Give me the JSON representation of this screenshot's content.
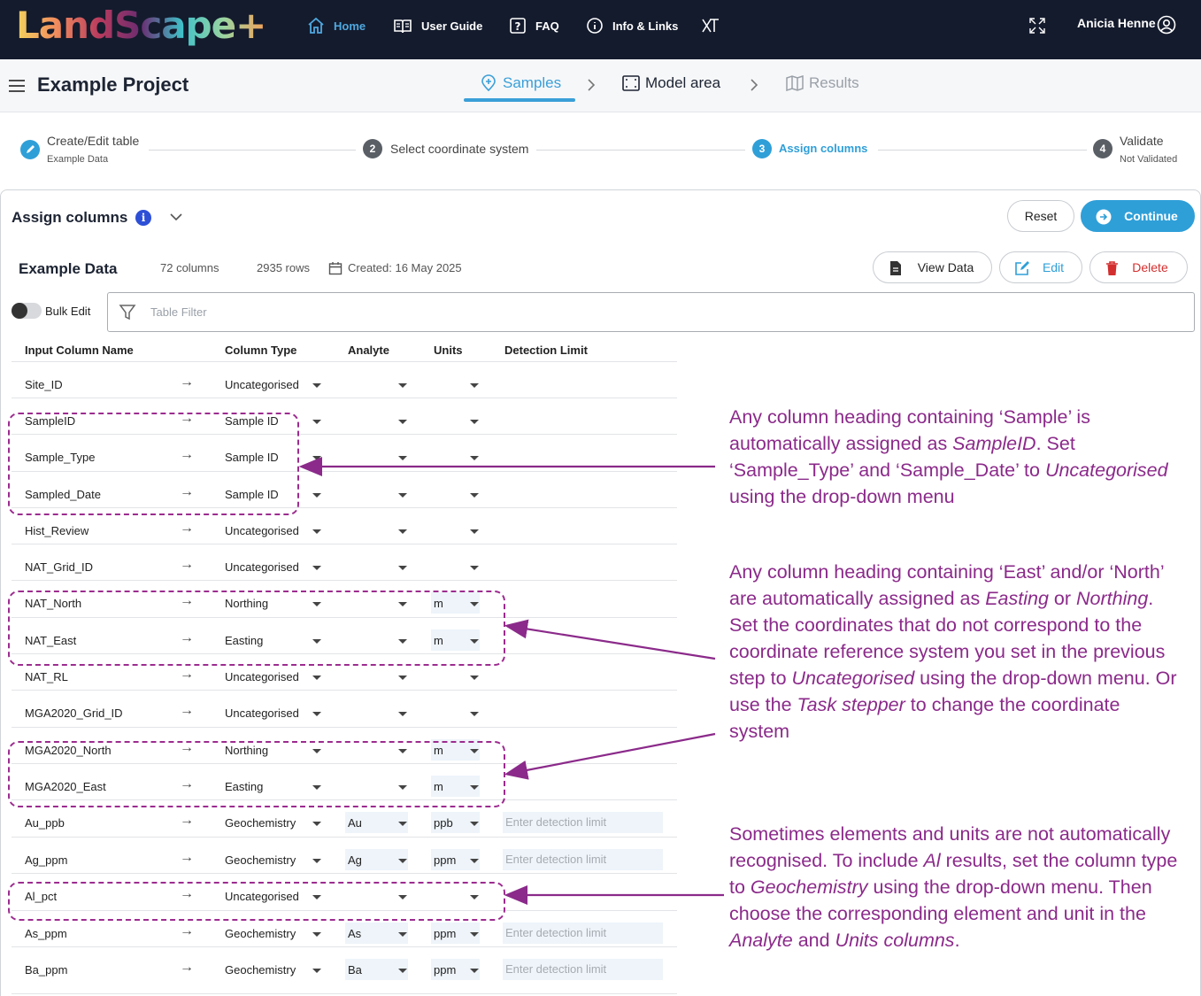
{
  "app": {
    "logo_text": "LandScape+",
    "nav": [
      {
        "label": "Home",
        "icon": "home-icon"
      },
      {
        "label": "User Guide",
        "icon": "book-icon"
      },
      {
        "label": "FAQ",
        "icon": "question-icon"
      },
      {
        "label": "Info & Links",
        "icon": "info-icon"
      }
    ],
    "extra_icon": "xt-logo-icon",
    "user_name": "Anicia Henne",
    "colors": {
      "nav_bg": "#141b2d",
      "accent": "#2f9fd8",
      "annotation": "#8b2a8a",
      "delete": "#d32f2f"
    }
  },
  "project": {
    "title": "Example Project",
    "stages": [
      {
        "label": "Samples",
        "state": "active"
      },
      {
        "label": "Model area",
        "state": "normal"
      },
      {
        "label": "Results",
        "state": "disabled"
      }
    ]
  },
  "stepper": [
    {
      "num": "",
      "title": "Create/Edit table",
      "sub": "Example Data",
      "state": "done"
    },
    {
      "num": "2",
      "title": "Select coordinate system",
      "sub": "",
      "state": "pending"
    },
    {
      "num": "3",
      "title": "Assign columns",
      "sub": "",
      "state": "active"
    },
    {
      "num": "4",
      "title": "Validate",
      "sub": "Not Validated",
      "state": "pending"
    }
  ],
  "assign": {
    "title": "Assign columns",
    "info_icon": "i",
    "reset_label": "Reset",
    "continue_label": "Continue"
  },
  "dataset": {
    "name": "Example Data",
    "columns": "72 columns",
    "rows": "2935 rows",
    "created": "Created: 16 May 2025",
    "view_label": "View Data",
    "edit_label": "Edit",
    "delete_label": "Delete"
  },
  "filter": {
    "bulk_edit_label": "Bulk Edit",
    "placeholder": "Table Filter"
  },
  "table": {
    "headers": [
      "Input Column Name",
      "Column Type",
      "Analyte",
      "Units",
      "Detection Limit"
    ],
    "detection_placeholder": "Enter detection limit",
    "rows": [
      {
        "name": "Site_ID",
        "type": "Uncategorised",
        "analyte": "",
        "units": ""
      },
      {
        "name": "SampleID",
        "type": "Sample ID",
        "analyte": "",
        "units": ""
      },
      {
        "name": "Sample_Type",
        "type": "Sample ID",
        "analyte": "",
        "units": ""
      },
      {
        "name": "Sampled_Date",
        "type": "Sample ID",
        "analyte": "",
        "units": ""
      },
      {
        "name": "Hist_Review",
        "type": "Uncategorised",
        "analyte": "",
        "units": ""
      },
      {
        "name": "NAT_Grid_ID",
        "type": "Uncategorised",
        "analyte": "",
        "units": ""
      },
      {
        "name": "NAT_North",
        "type": "Northing",
        "analyte": "",
        "units": "m"
      },
      {
        "name": "NAT_East",
        "type": "Easting",
        "analyte": "",
        "units": "m"
      },
      {
        "name": "NAT_RL",
        "type": "Uncategorised",
        "analyte": "",
        "units": ""
      },
      {
        "name": "MGA2020_Grid_ID",
        "type": "Uncategorised",
        "analyte": "",
        "units": ""
      },
      {
        "name": "MGA2020_North",
        "type": "Northing",
        "analyte": "",
        "units": "m"
      },
      {
        "name": "MGA2020_East",
        "type": "Easting",
        "analyte": "",
        "units": "m"
      },
      {
        "name": "Au_ppb",
        "type": "Geochemistry",
        "analyte": "Au",
        "units": "ppb",
        "detection": true
      },
      {
        "name": "Ag_ppm",
        "type": "Geochemistry",
        "analyte": "Ag",
        "units": "ppm",
        "detection": true
      },
      {
        "name": "Al_pct",
        "type": "Uncategorised",
        "analyte": "",
        "units": ""
      },
      {
        "name": "As_ppm",
        "type": "Geochemistry",
        "analyte": "As",
        "units": "ppm",
        "detection": true
      },
      {
        "name": "Ba_ppm",
        "type": "Geochemistry",
        "analyte": "Ba",
        "units": "ppm",
        "detection": true
      }
    ]
  },
  "annotations": [
    "Any column heading containing ‘Sample’ is automatically assigned as SampleID. Set ‘Sample_Type’ and ‘Sample_Date’ to Uncategorised using the drop-down menu",
    "Any column heading containing ‘East’ and/or ‘North’ are automatically assigned as Easting or Northing. Set the coordinates that do not correspond to the coordinate reference system you set in the previous step to Uncategorised using the drop-down menu. Or use the Task stepper to change the coordinate system",
    "Sometimes elements and units are not automatically recognised. To include Al results, set the column type to Geochemistry using the drop-down menu. Then choose the corresponding element and unit in the Analyte and Units columns."
  ]
}
